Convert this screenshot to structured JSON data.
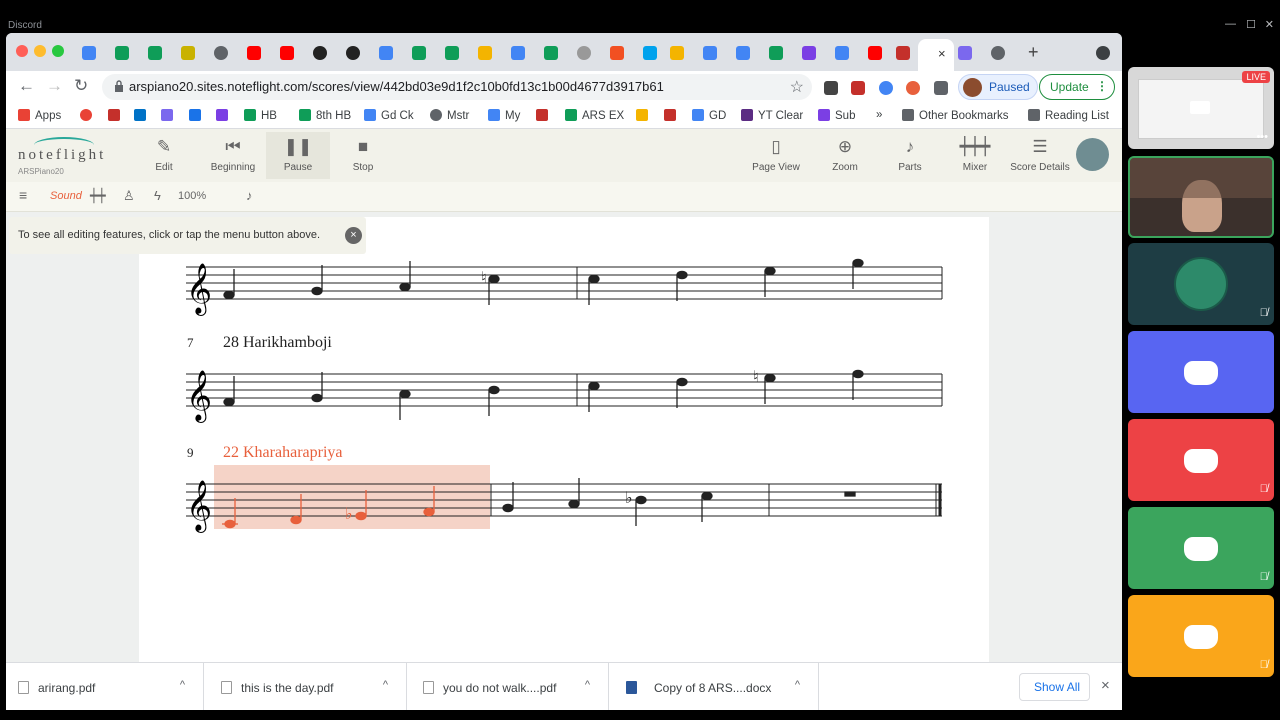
{
  "discord": {
    "title": "Discord"
  },
  "browser": {
    "url": "arspiano20.sites.noteflight.com/scores/view/442bd03e9d1f2c10b0fd13c1b00d4677d3917b61",
    "active_tab_close": "×",
    "new_tab": "+",
    "paused_label": "Paused",
    "update_label": "Update",
    "bookmarks": [
      "Apps",
      "HB",
      "8th HB",
      "Gd Ck",
      "Mstr",
      "My",
      "ARS EX",
      "GD",
      "YT Clear",
      "Sub",
      "»",
      "Other Bookmarks",
      "Reading List"
    ]
  },
  "noteflight": {
    "logo": "noteflight",
    "account": "ARSPiano20",
    "toolbar": [
      {
        "label": "Edit",
        "icon": "pencil-icon"
      },
      {
        "label": "Beginning",
        "icon": "rewind-icon"
      },
      {
        "label": "Pause",
        "icon": "pause-icon"
      },
      {
        "label": "Stop",
        "icon": "stop-icon"
      },
      {
        "label": "Page View",
        "icon": "page-icon"
      },
      {
        "label": "Zoom",
        "icon": "zoom-icon"
      },
      {
        "label": "Parts",
        "icon": "guitar-icon"
      },
      {
        "label": "Mixer",
        "icon": "mixer-icon"
      },
      {
        "label": "Score Details",
        "icon": "list-icon"
      }
    ],
    "sub_toolbar": {
      "sound_label": "Sound",
      "zoom": "100%"
    },
    "hint": "To see all editing features, click or tap the menu button above.",
    "hint_close": "×"
  },
  "score": {
    "systems": [
      {
        "measure": "",
        "title": ""
      },
      {
        "measure": "7",
        "title": "28 Harikhamboji"
      },
      {
        "measure": "9",
        "title": "22 Kharaharapriya"
      }
    ],
    "highlight_color": "#f5d3c7",
    "playing_color": "#e8603c"
  },
  "downloads": {
    "items": [
      "arirang.pdf",
      "this is the day.pdf",
      "you do not walk....pdf",
      "Copy of 8 ARS....docx"
    ],
    "caret": "^",
    "show_all": "Show All",
    "close": "×"
  },
  "sidebar": {
    "live_badge": "LIVE"
  }
}
